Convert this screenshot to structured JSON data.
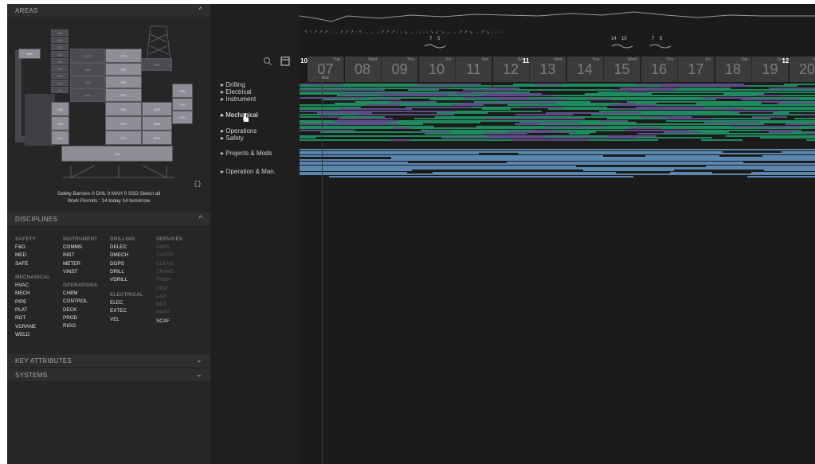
{
  "areas": {
    "title": "AREAS",
    "blocks": [
      "H00",
      "L90",
      "L80",
      "L70",
      "L60",
      "L50",
      "L40",
      "L30",
      "L20",
      "L10",
      "U70",
      "U60",
      "U50",
      "U40",
      "U30",
      "U20",
      "U10",
      "P70",
      "P62",
      "P50",
      "P40",
      "P30",
      "P20",
      "P10",
      "P90",
      "W30",
      "W20",
      "W10",
      "F30",
      "F20",
      "F10",
      "J00"
    ],
    "barriers_text": "Safety Barriers  0 DHL  0 MAH  0 SSD  Select all",
    "permits_text": "Work Permits :  14 today  14 tomorrow"
  },
  "disciplines": {
    "title": "DISCIPLINES",
    "safety_head": "SAFETY",
    "safety": [
      "F&G",
      "MED",
      "SAFE"
    ],
    "mechanical_head": "MECHANICAL",
    "mechanical": [
      "HVAC",
      "MECH",
      "PIPE",
      "PLAT",
      "ROT",
      "VCRANE",
      "WELD"
    ],
    "instrument_head": "INSTRUMENT",
    "instrument": [
      "COMMS",
      "INST",
      "METER",
      "VINST"
    ],
    "operations_head": "OPERATIONS",
    "operations": [
      "CHEM",
      "CONTROL",
      "DECK",
      "PROD",
      "RIGG"
    ],
    "drilling_head": "DRILLING",
    "drilling": [
      "DELEC",
      "DMECH",
      "DOPS",
      "DRILL",
      "VDRILL"
    ],
    "electrical_head": "ELECTRICAL",
    "electrical": [
      "ELEC",
      "EXTEC",
      "VEL"
    ],
    "services_head": "SERVICES",
    "services": [
      "ABEIL",
      "CATER",
      "CLEAN",
      "CRANE",
      "FABM",
      "INSP",
      "LAG",
      "NDT",
      "PAINT",
      "SCAF"
    ]
  },
  "key_attributes": {
    "title": "KEY ATTRIBUTES"
  },
  "systems": {
    "title": "SYSTEMS"
  },
  "categories": [
    "Drilling",
    "Electrical",
    "Instrument",
    "Mechanical",
    "Operations",
    "Safety",
    "Projects & Mods",
    "Operation & Man."
  ],
  "timeline": {
    "weeks": [
      "10",
      "11",
      "12"
    ],
    "days": [
      {
        "name": "Tue",
        "num": "07",
        "sub": "Mar"
      },
      {
        "name": "Wed",
        "num": "08"
      },
      {
        "name": "Thu",
        "num": "09"
      },
      {
        "name": "Fri",
        "num": "10"
      },
      {
        "name": "Sat",
        "num": "11"
      },
      {
        "name": "Sun",
        "num": "12"
      },
      {
        "name": "Mon",
        "num": "13"
      },
      {
        "name": "Tue",
        "num": "14"
      },
      {
        "name": "Wed",
        "num": "15"
      },
      {
        "name": "Thu",
        "num": "16"
      },
      {
        "name": "Fri",
        "num": "17"
      },
      {
        "name": "Sat",
        "num": "18"
      },
      {
        "name": "Sun",
        "num": "19"
      },
      {
        "name": "Mon",
        "num": "20"
      }
    ],
    "values": [
      "7",
      "5",
      "14",
      "10",
      "7",
      "5"
    ],
    "colors": {
      "green": "#1e8a5e",
      "blue": "#5a87b0",
      "purple": "#5b4d86",
      "dark": "#1b1b1b"
    }
  }
}
